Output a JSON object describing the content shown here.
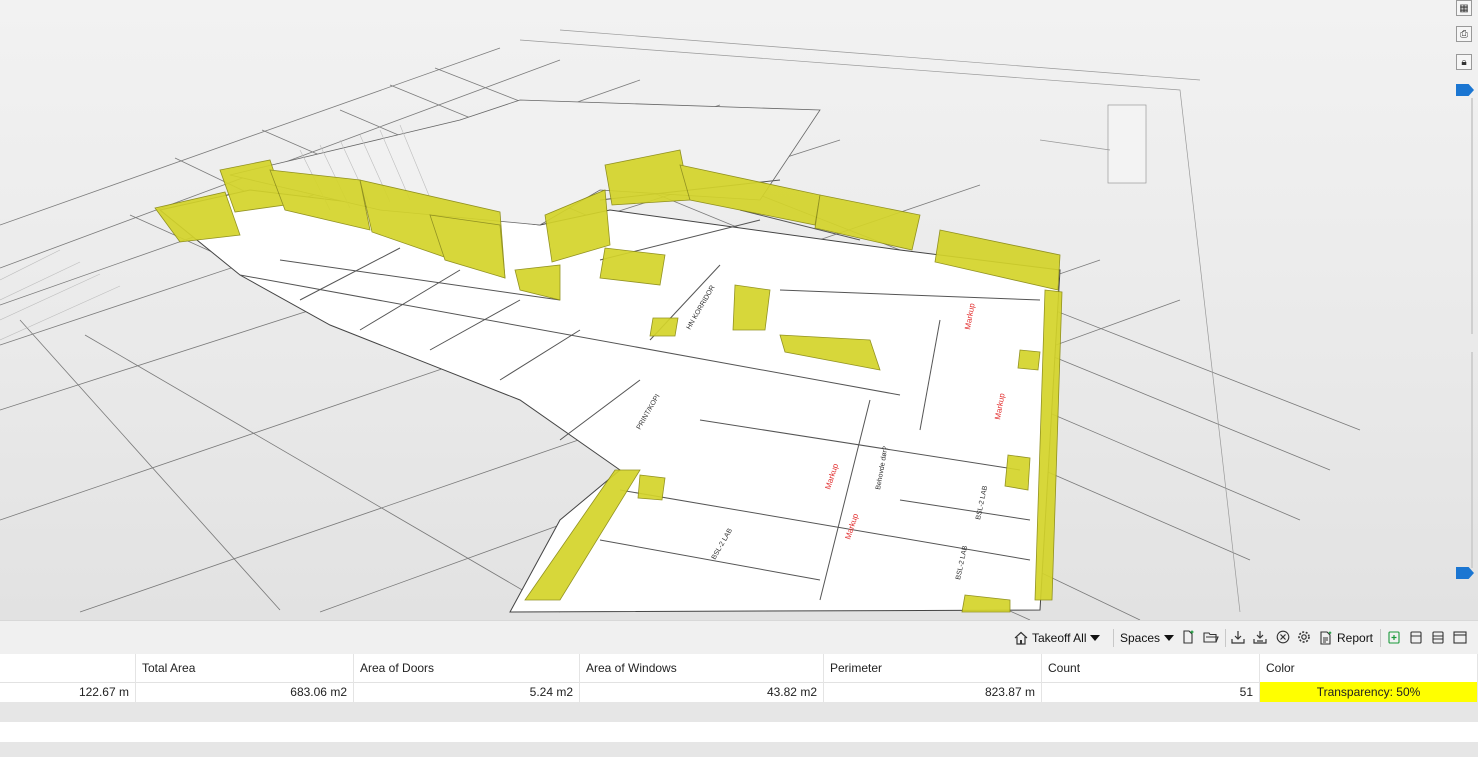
{
  "toolbar": {
    "takeoff_label": "Takeoff All",
    "spaces_label": "Spaces",
    "report_label": "Report"
  },
  "table": {
    "columns": [
      "",
      "Total Area",
      "Area of Doors",
      "Area of Windows",
      "Perimeter",
      "Count",
      "Color"
    ],
    "row": {
      "c0": "122.67 m",
      "total_area": "683.06 m2",
      "area_doors": "5.24 m2",
      "area_windows": "43.82 m2",
      "perimeter": "823.87 m",
      "count": "51",
      "color": "Transparency: 50%"
    }
  },
  "colors": {
    "space_fill": "#d4d42a",
    "color_cell": "#ffff00",
    "accent": "#1b76d2"
  },
  "icons": [
    "home-icon",
    "chevron-down-icon",
    "new-document-icon",
    "open-folder-icon",
    "download-icon",
    "import-icon",
    "cancel-icon",
    "settings-icon",
    "report-icon",
    "add-layer-icon",
    "layer-icon",
    "layers-icon",
    "window-icon",
    "split-view-icon",
    "pdf-icon",
    "lock-icon"
  ]
}
